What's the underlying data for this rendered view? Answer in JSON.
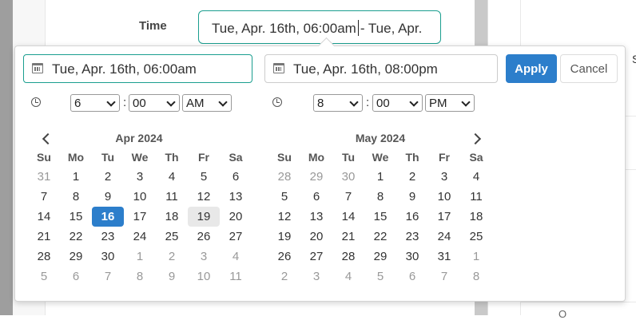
{
  "field": {
    "label": "Time",
    "value_before_caret": "Tue, Apr. 16th, 06:00am",
    "value_after_caret": "- Tue, Apr."
  },
  "background": {
    "fragment_right": "S",
    "fragment_bottom": "O"
  },
  "picker": {
    "start_input": "Tue, Apr. 16th, 06:00am",
    "end_input": "Tue, Apr. 16th, 08:00pm",
    "apply_label": "Apply",
    "cancel_label": "Cancel",
    "start_time": {
      "hour": "6",
      "minute": "00",
      "ampm": "AM"
    },
    "end_time": {
      "hour": "8",
      "minute": "00",
      "ampm": "PM"
    },
    "separator": ":",
    "accent_color": "#2c7ecb",
    "focus_color": "#1a9e8f"
  },
  "weekdays": [
    "Su",
    "Mo",
    "Tu",
    "We",
    "Th",
    "Fr",
    "Sa"
  ],
  "calendars": [
    {
      "title": "Apr 2024",
      "days": [
        [
          "31",
          "1",
          "2",
          "3",
          "4",
          "5",
          "6"
        ],
        [
          "7",
          "8",
          "9",
          "10",
          "11",
          "12",
          "13"
        ],
        [
          "14",
          "15",
          "16",
          "17",
          "18",
          "19",
          "20"
        ],
        [
          "21",
          "22",
          "23",
          "24",
          "25",
          "26",
          "27"
        ],
        [
          "28",
          "29",
          "30",
          "1",
          "2",
          "3",
          "4"
        ],
        [
          "5",
          "6",
          "7",
          "8",
          "9",
          "10",
          "11"
        ]
      ],
      "off": [
        [
          0,
          0
        ],
        [
          4,
          3
        ],
        [
          4,
          4
        ],
        [
          4,
          5
        ],
        [
          4,
          6
        ],
        [
          5,
          0
        ],
        [
          5,
          1
        ],
        [
          5,
          2
        ],
        [
          5,
          3
        ],
        [
          5,
          4
        ],
        [
          5,
          5
        ],
        [
          5,
          6
        ]
      ],
      "selected": [
        2,
        2
      ],
      "hover": [
        2,
        5
      ]
    },
    {
      "title": "May 2024",
      "days": [
        [
          "28",
          "29",
          "30",
          "1",
          "2",
          "3",
          "4"
        ],
        [
          "5",
          "6",
          "7",
          "8",
          "9",
          "10",
          "11"
        ],
        [
          "12",
          "13",
          "14",
          "15",
          "16",
          "17",
          "18"
        ],
        [
          "19",
          "20",
          "21",
          "22",
          "23",
          "24",
          "25"
        ],
        [
          "26",
          "27",
          "28",
          "29",
          "30",
          "31",
          "1"
        ],
        [
          "2",
          "3",
          "4",
          "5",
          "6",
          "7",
          "8"
        ]
      ],
      "off": [
        [
          0,
          0
        ],
        [
          0,
          1
        ],
        [
          0,
          2
        ],
        [
          4,
          6
        ],
        [
          5,
          0
        ],
        [
          5,
          1
        ],
        [
          5,
          2
        ],
        [
          5,
          3
        ],
        [
          5,
          4
        ],
        [
          5,
          5
        ],
        [
          5,
          6
        ]
      ],
      "selected": null,
      "hover": null
    }
  ]
}
